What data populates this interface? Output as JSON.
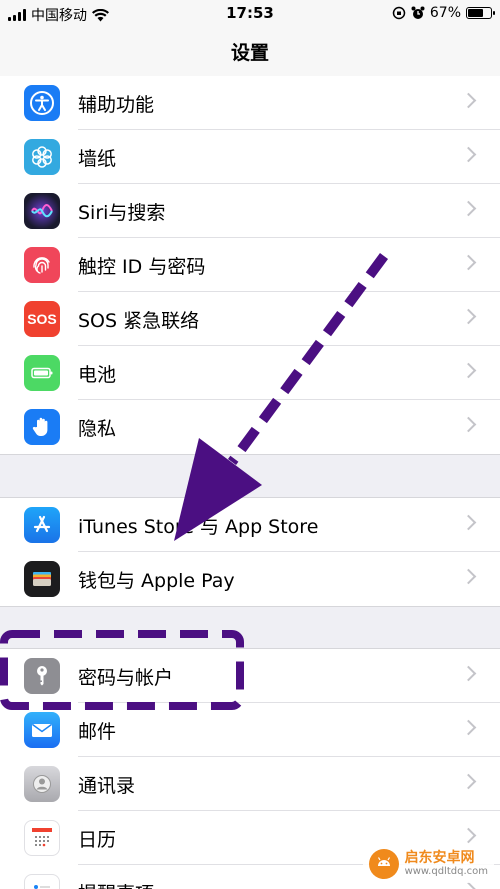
{
  "status_bar": {
    "carrier": "中国移动",
    "time": "17:53",
    "battery_percent": "67%",
    "battery_level": 0.67
  },
  "nav": {
    "title": "设置"
  },
  "groups": [
    {
      "items": [
        {
          "label": "辅助功能",
          "icon": "accessibility-icon",
          "color": "#1a7cf5"
        },
        {
          "label": "墙纸",
          "icon": "wallpaper-flower-icon",
          "color": "#33a9e0"
        },
        {
          "label": "Siri与搜索",
          "icon": "siri-icon",
          "color": "#1a1a2e"
        },
        {
          "label": "触控 ID 与密码",
          "icon": "fingerprint-icon",
          "color": "#f0465a"
        },
        {
          "label": "SOS 紧急联络",
          "icon": "sos-icon",
          "icon_text": "SOS",
          "color": "#f0412f"
        },
        {
          "label": "电池",
          "icon": "battery-icon",
          "color": "#4cd964"
        },
        {
          "label": "隐私",
          "icon": "hand-icon",
          "color": "#1a7cf5"
        }
      ]
    },
    {
      "items": [
        {
          "label": "iTunes Store 与 App Store",
          "icon": "app-store-icon",
          "color": "#1d8ef5"
        },
        {
          "label": "钱包与 Apple Pay",
          "icon": "wallet-icon",
          "color": "#1c1c1e"
        }
      ]
    },
    {
      "items": [
        {
          "label": "密码与帐户",
          "icon": "key-icon",
          "color": "#8e8e93"
        },
        {
          "label": "邮件",
          "icon": "mail-icon",
          "color": "#1a84f5"
        },
        {
          "label": "通讯录",
          "icon": "contacts-icon",
          "color": "#b9b9bd"
        },
        {
          "label": "日历",
          "icon": "calendar-icon",
          "color": "#ffffff"
        },
        {
          "label": "提醒事项",
          "icon": "reminders-icon",
          "color": "#ffffff"
        }
      ]
    }
  ],
  "watermark": {
    "name": "启东安卓网",
    "url": "www.qdltdq.com"
  },
  "annotation_color": "#4b0f82"
}
